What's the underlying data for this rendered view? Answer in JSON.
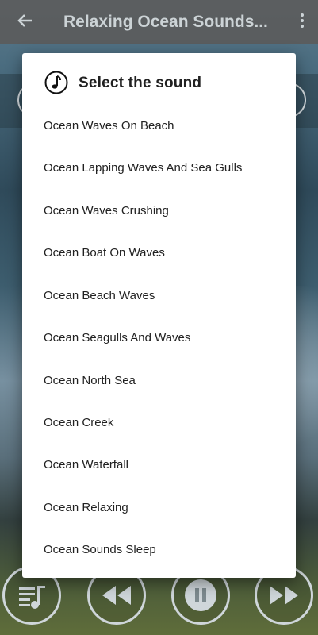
{
  "app_bar": {
    "title": "Relaxing Ocean Sounds..."
  },
  "dialog": {
    "title": "Select the sound",
    "items": [
      "Ocean Waves On Beach",
      "Ocean Lapping Waves And Sea Gulls",
      "Ocean Waves Crushing",
      "Ocean Boat On Waves",
      "Ocean Beach Waves",
      "Ocean Seagulls And Waves",
      "Ocean North Sea",
      "Ocean Creek",
      "Ocean Waterfall",
      "Ocean Relaxing",
      "Ocean Sounds Sleep"
    ]
  },
  "controls": {
    "icons": [
      "playlist-icon",
      "rewind-icon",
      "pause-icon",
      "fast-forward-icon"
    ]
  },
  "colors": {
    "appbar": "#5b5b5b",
    "dialog_bg": "#ffffff",
    "text": "#212121",
    "control_stroke": "#cfd6da"
  }
}
